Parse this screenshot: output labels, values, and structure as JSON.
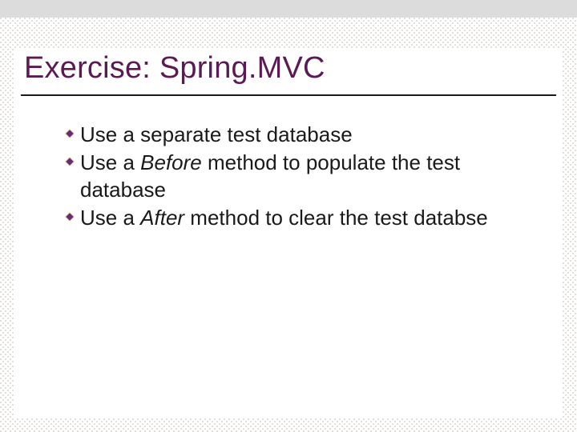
{
  "slide": {
    "title": "Exercise: Spring.MVC",
    "bullets": [
      {
        "before": "Use a separate test database",
        "italic": "",
        "after": ""
      },
      {
        "before": "Use a ",
        "italic": "Before",
        "after": " method to populate the test database"
      },
      {
        "before": "Use a ",
        "italic": "After",
        "after": " method to clear the test databse"
      }
    ]
  },
  "theme": {
    "title_color": "#5b1a53",
    "bullet_color": "#6a2a75",
    "text_color": "#1a1a1a"
  }
}
